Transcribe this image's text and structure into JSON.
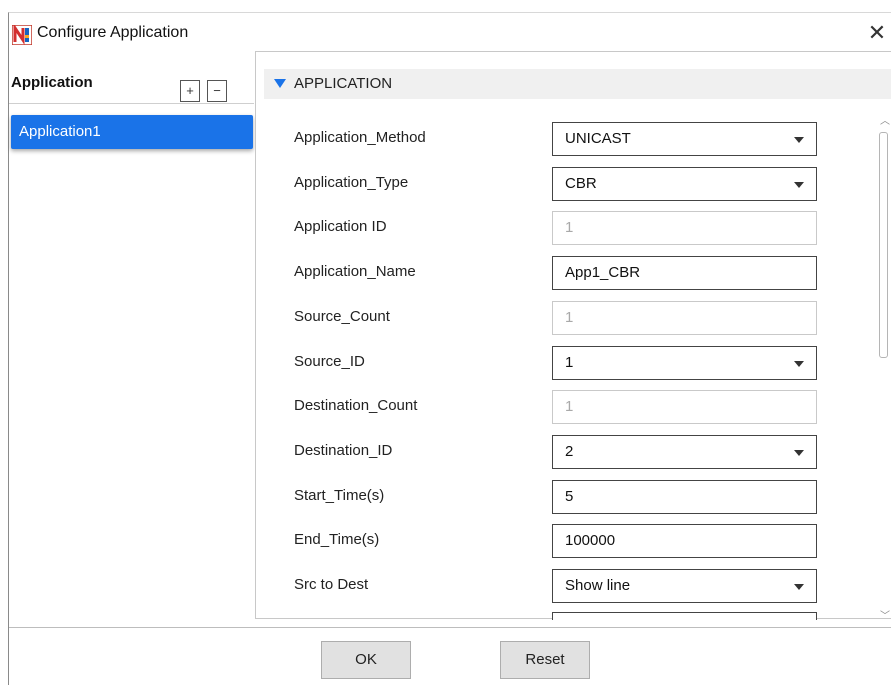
{
  "window": {
    "title": "Configure Application",
    "close_glyph": "✕",
    "logo_icon": "netsim-logo-icon"
  },
  "left_panel": {
    "heading": "Application",
    "add_label": "+",
    "remove_label": "−",
    "items": [
      {
        "label": "Application1",
        "selected": true
      }
    ]
  },
  "section": {
    "title": "APPLICATION",
    "expanded": true
  },
  "fields": {
    "application_method": {
      "label": "Application_Method",
      "value": "UNICAST"
    },
    "application_type": {
      "label": "Application_Type",
      "value": "CBR"
    },
    "application_id": {
      "label": "Application ID",
      "value": "1"
    },
    "application_name": {
      "label": "Application_Name",
      "value": "App1_CBR"
    },
    "source_count": {
      "label": "Source_Count",
      "value": "1"
    },
    "source_id": {
      "label": "Source_ID",
      "value": "1"
    },
    "destination_count": {
      "label": "Destination_Count",
      "value": "1"
    },
    "destination_id": {
      "label": "Destination_ID",
      "value": "2"
    },
    "start_time": {
      "label": "Start_Time(s)",
      "value": "5"
    },
    "end_time": {
      "label": "End_Time(s)",
      "value": "100000"
    },
    "src_to_dest": {
      "label": "Src to Dest",
      "value": "Show line"
    },
    "next_field": {
      "label": "",
      "value": ""
    }
  },
  "buttons": {
    "ok": "OK",
    "reset": "Reset"
  },
  "colors": {
    "accent": "#1a73e8",
    "section_bg": "#f0f0f0",
    "button_bg": "#e1e1e1"
  }
}
